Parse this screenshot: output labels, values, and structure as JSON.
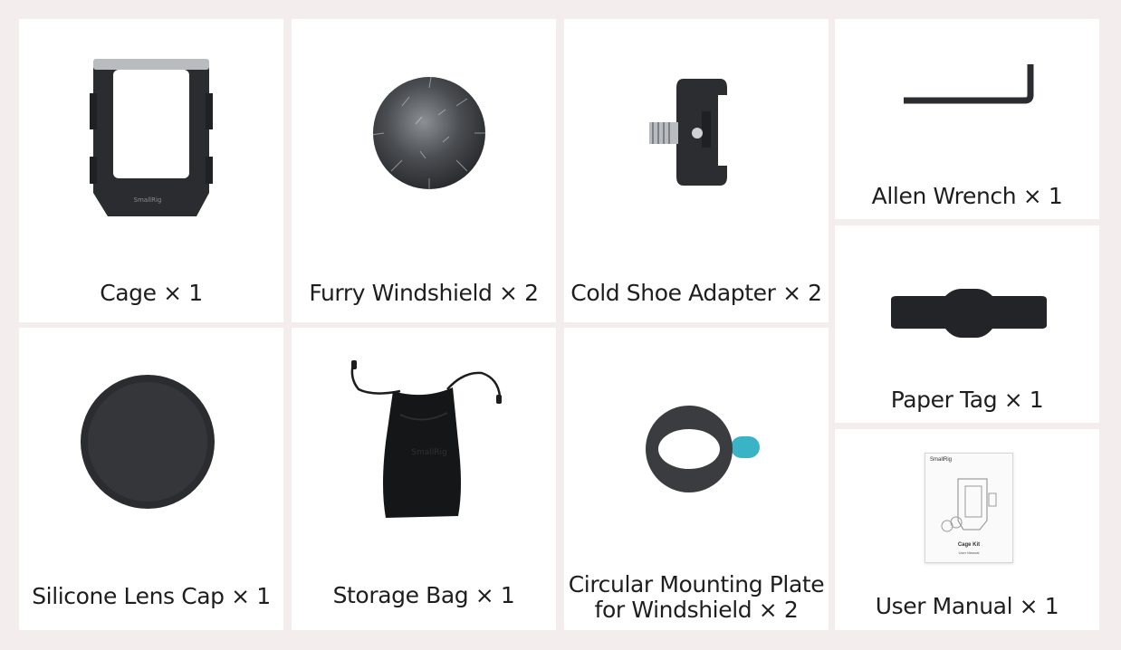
{
  "items": [
    {
      "label": "Cage × 1",
      "icon": "cage-icon"
    },
    {
      "label": "Furry Windshield × 2",
      "icon": "furry-windshield-icon"
    },
    {
      "label": "Cold Shoe Adapter × 2",
      "icon": "cold-shoe-adapter-icon"
    },
    {
      "label": "Allen Wrench × 1",
      "icon": "allen-wrench-icon"
    },
    {
      "label": "Paper Tag × 1",
      "icon": "paper-tag-icon"
    },
    {
      "label": "Silicone Lens Cap × 1",
      "icon": "lens-cap-icon"
    },
    {
      "label": "Storage Bag × 1",
      "icon": "storage-bag-icon"
    },
    {
      "label_line1": "Circular Mounting Plate",
      "label_line2": "for Windshield × 2",
      "icon": "mounting-plate-icon"
    },
    {
      "label": "User Manual × 1",
      "icon": "user-manual-icon"
    }
  ],
  "manual": {
    "brand": "SmallRig",
    "title": "Cage Kit",
    "subtitle": "User Manual"
  },
  "cage_brand": "SmallRig",
  "bag_brand": "SmallRig",
  "colors": {
    "background": "#f3eded",
    "card": "#ffffff",
    "text": "#1e1e1e",
    "accent_tab": "#3bb3c6"
  }
}
